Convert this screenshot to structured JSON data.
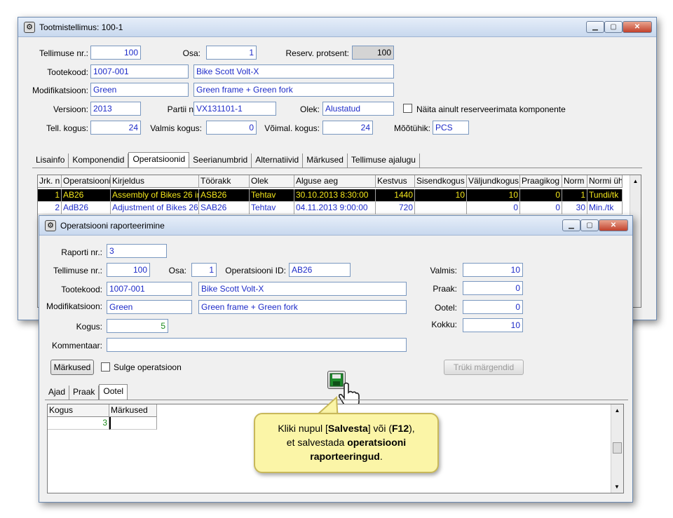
{
  "main_window": {
    "title": "Tootmistellimus: 100-1",
    "fields": {
      "order_no_label": "Tellimuse nr.:",
      "order_no": "100",
      "part_label": "Osa:",
      "part": "1",
      "reserve_label": "Reserv. protsent:",
      "reserve": "100",
      "product_code_label": "Tootekood:",
      "product_code": "1007-001",
      "product_name": "Bike Scott Volt-X",
      "modification_label": "Modifikatsioon:",
      "modification": "Green",
      "modification_desc": "Green frame + Green fork",
      "version_label": "Versioon:",
      "version": "2013",
      "batch_label": "Partii nr.:",
      "batch": "VX131101-1",
      "status_label": "Olek:",
      "status": "Alustatud",
      "show_unreserved_label": "Näita ainult reserveerimata komponente",
      "ordered_qty_label": "Tell. kogus:",
      "ordered_qty": "24",
      "ready_qty_label": "Valmis kogus:",
      "ready_qty": "0",
      "possible_qty_label": "Võimal. kogus:",
      "possible_qty": "24",
      "unit_label": "Mõõtühik:",
      "unit": "PCS"
    },
    "tabs": [
      "Lisainfo",
      "Komponendid",
      "Operatsioonid",
      "Seerianumbrid",
      "Alternatiivid",
      "Märkused",
      "Tellimuse ajalugu"
    ],
    "grid": {
      "headers": [
        "Jrk. n",
        "Operatsiooni",
        "Kirjeldus",
        "Töörakk",
        "Olek",
        "Alguse aeg",
        "Kestvus",
        "Sisendkogus",
        "Väljundkogus",
        "Praagikog",
        "Norm",
        "Normi üh"
      ],
      "rows": [
        [
          "1",
          "AB26",
          "Assembly of Bikes 26 in",
          "ASB26",
          "Tehtav",
          "30.10.2013 8:30:00",
          "1440",
          "10",
          "10",
          "0",
          "1",
          "Tundi/tk"
        ],
        [
          "2",
          "AdB26",
          "Adjustment of Bikes 26",
          "SAB26",
          "Tehtav",
          "04.11.2013 9:00:00",
          "720",
          "",
          "0",
          "0",
          "30",
          "Min./tk"
        ]
      ]
    }
  },
  "report_window": {
    "title": "Operatsiooni raporteerimine",
    "fields": {
      "report_no_label": "Raporti nr.:",
      "report_no": "3",
      "order_no_label": "Tellimuse nr.:",
      "order_no": "100",
      "part_label": "Osa:",
      "part": "1",
      "operation_id_label": "Operatsiooni ID:",
      "operation_id": "AB26",
      "product_code_label": "Tootekood:",
      "product_code": "1007-001",
      "product_name": "Bike Scott Volt-X",
      "modification_label": "Modifikatsioon:",
      "modification": "Green",
      "modification_desc": "Green frame + Green fork",
      "quantity_label": "Kogus:",
      "quantity": "5",
      "comment_label": "Kommentaar:",
      "comment": "",
      "ready_label": "Valmis:",
      "ready": "10",
      "scrap_label": "Praak:",
      "scrap": "0",
      "waiting_label": "Ootel:",
      "waiting": "0",
      "total_label": "Kokku:",
      "total": "10"
    },
    "buttons": {
      "notes": "Märkused",
      "close_operation": "Sulge operatsioon",
      "print_labels": "Trüki märgendid"
    },
    "tabs": [
      "Ajad",
      "Praak",
      "Ootel"
    ],
    "grid": {
      "headers": [
        "Kogus",
        "Märkused"
      ],
      "rows": [
        [
          "3",
          ""
        ]
      ]
    }
  },
  "tooltip": {
    "line1_a": "Kliki nupul [",
    "line1_b": "Salvesta",
    "line1_c": "] või (",
    "line1_d": "F12",
    "line1_e": "),",
    "line2_a": "et salvestada ",
    "line2_b": "operatsiooni",
    "line3_a": "raporteeringud",
    "line3_b": "."
  }
}
